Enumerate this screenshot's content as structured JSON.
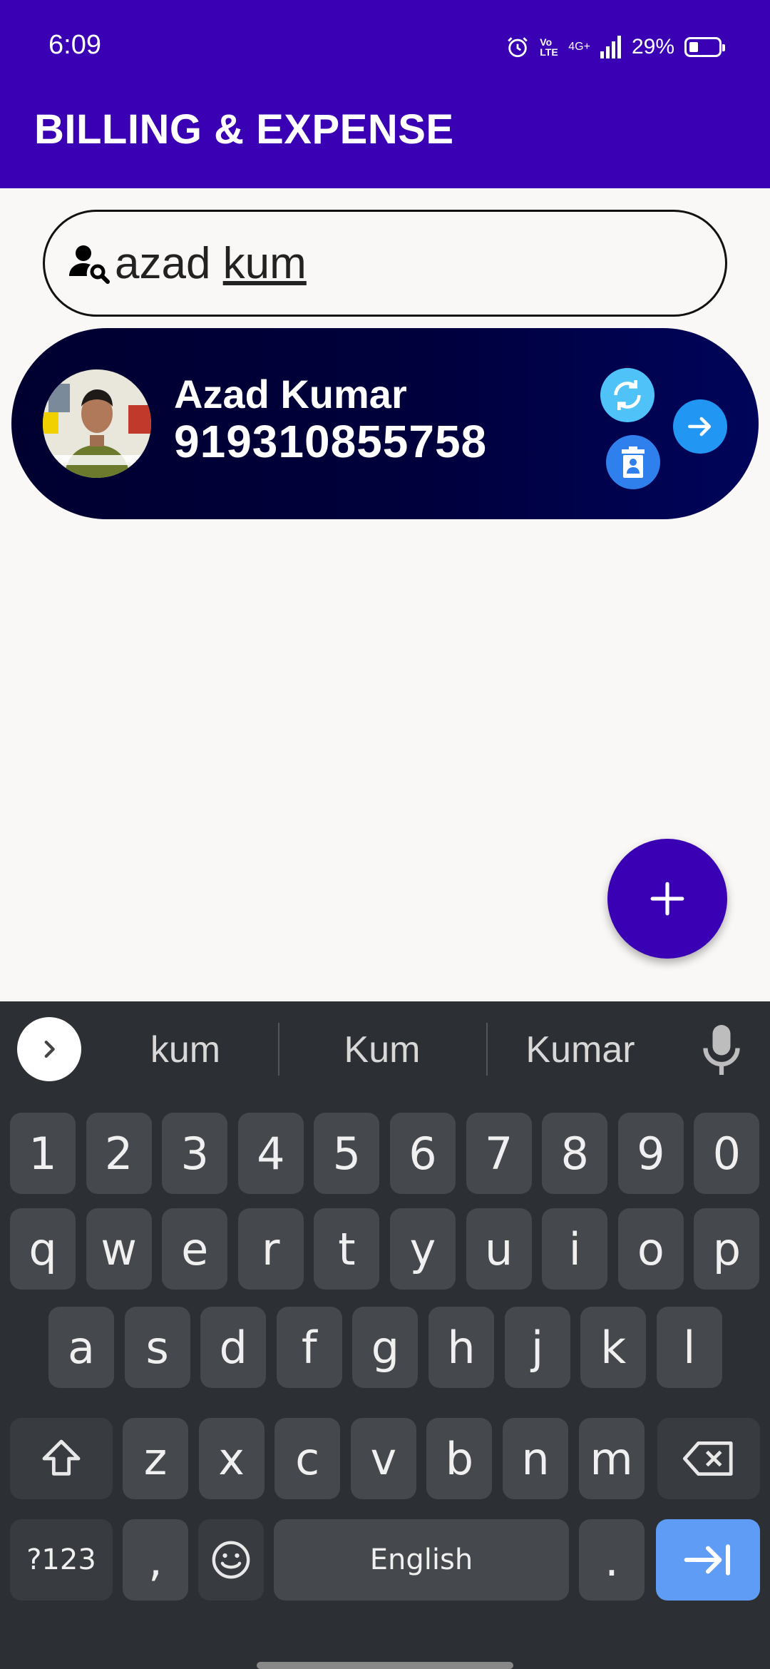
{
  "status_bar": {
    "time": "6:09",
    "network": "4G+",
    "volte": "Vo LTE",
    "battery": "29%"
  },
  "app": {
    "title": "BILLING & EXPENSE"
  },
  "search": {
    "typed_prefix": "azad ",
    "typed_composing": "kum"
  },
  "contacts": [
    {
      "name": "Azad Kumar",
      "phone": "919310855758"
    }
  ],
  "keyboard": {
    "suggestions": [
      "kum",
      "Kum",
      "Kumar"
    ],
    "rows": [
      [
        "1",
        "2",
        "3",
        "4",
        "5",
        "6",
        "7",
        "8",
        "9",
        "0"
      ],
      [
        "q",
        "w",
        "e",
        "r",
        "t",
        "y",
        "u",
        "i",
        "o",
        "p"
      ],
      [
        "a",
        "s",
        "d",
        "f",
        "g",
        "h",
        "j",
        "k",
        "l"
      ],
      [
        "z",
        "x",
        "c",
        "v",
        "b",
        "n",
        "m"
      ]
    ],
    "symbols_label": "?123",
    "comma_label": ",",
    "space_label": "English",
    "period_label": "."
  },
  "colors": {
    "primary": "#3a00b4",
    "card": "#00003c",
    "accent_blue": "#2196f3"
  }
}
